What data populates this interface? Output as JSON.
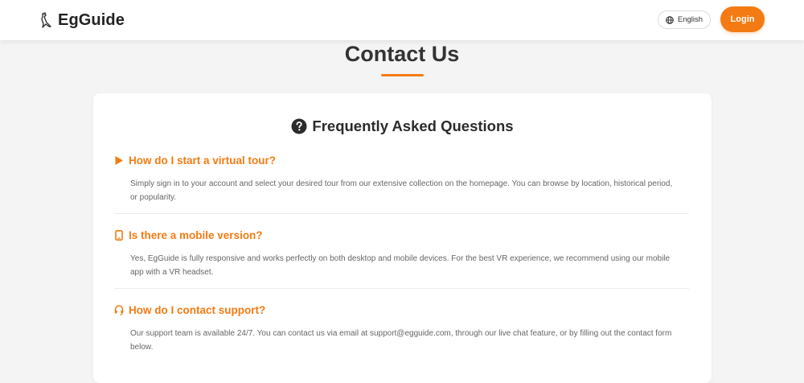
{
  "header": {
    "brand_name": "EgGuide",
    "language_label": "English",
    "login_label": "Login"
  },
  "page": {
    "title": "Contact Us"
  },
  "faq": {
    "heading": "Frequently Asked Questions",
    "items": [
      {
        "icon": "play-icon",
        "question": "How do I start a virtual tour?",
        "answer": "Simply sign in to your account and select your desired tour from our extensive collection on the homepage. You can browse by location, historical period, or popularity."
      },
      {
        "icon": "mobile-icon",
        "question": "Is there a mobile version?",
        "answer": "Yes, EgGuide is fully responsive and works perfectly on both desktop and mobile devices. For the best VR experience, we recommend using our mobile app with a VR headset."
      },
      {
        "icon": "headset-icon",
        "question": "How do I contact support?",
        "answer": "Our support team is available 24/7. You can contact us via email at support@egguide.com, through our live chat feature, or by filling out the contact form below."
      }
    ]
  },
  "colors": {
    "accent": "#f47b13",
    "background": "#f4f4f4",
    "card": "#ffffff"
  }
}
